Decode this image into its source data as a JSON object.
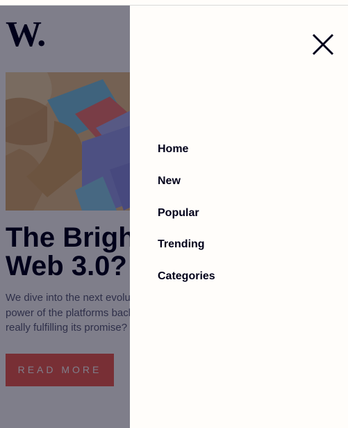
{
  "brand": {
    "logo_text": "W."
  },
  "article": {
    "headline_line1": "The Bright Future of",
    "headline_line2": "Web 3.0?",
    "description_line1": "We dive into the next evolution of the web that claims to put the",
    "description_line2": "power of the platforms back into the hands of the people. But is it",
    "description_line3": "really fulfilling its promise?",
    "cta_label": "READ MORE"
  },
  "menu": {
    "close_icon": "close-icon",
    "items": [
      {
        "label": "Home"
      },
      {
        "label": "New"
      },
      {
        "label": "Popular"
      },
      {
        "label": "Trending"
      },
      {
        "label": "Categories"
      }
    ]
  },
  "colors": {
    "background": "#fffdfa",
    "text_dark": "#00001a",
    "accent": "#f15e50",
    "muted_text": "#5d5f79",
    "overlay": "rgba(0,0,26,0.5)"
  }
}
